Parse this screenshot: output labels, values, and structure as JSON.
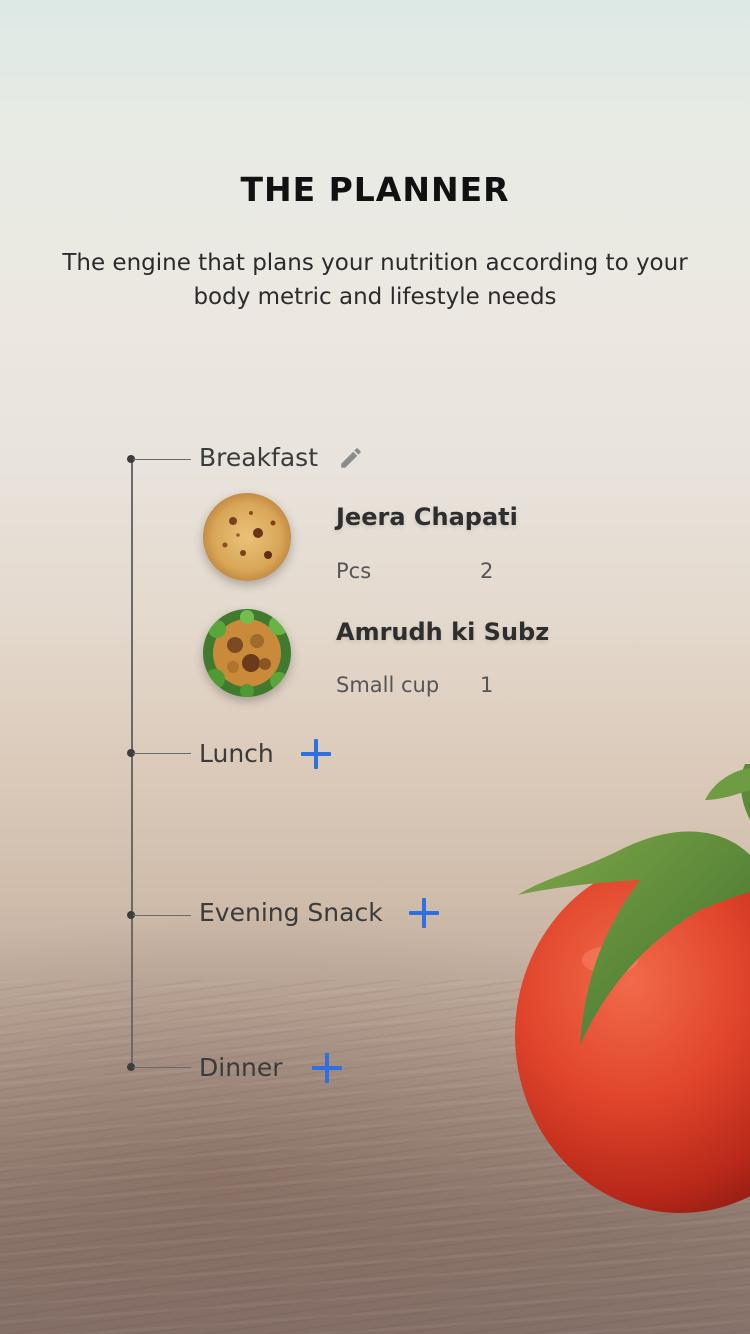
{
  "header": {
    "title": "THE PLANNER",
    "subtitle": "The engine that plans your nutrition according to your body metric and lifestyle needs"
  },
  "planner": {
    "meals": [
      {
        "label": "Breakfast",
        "action_icon": "pencil-icon",
        "items": [
          {
            "name": "Jeera Chapati",
            "unit": "Pcs",
            "qty": "2",
            "image_icon": "chapati-photo"
          },
          {
            "name": "Amrudh ki Subz",
            "unit": "Small cup",
            "qty": "1",
            "image_icon": "subz-photo"
          }
        ]
      },
      {
        "label": "Lunch",
        "action_icon": "plus-icon",
        "items": []
      },
      {
        "label": "Evening Snack",
        "action_icon": "plus-icon",
        "items": []
      },
      {
        "label": "Dinner",
        "action_icon": "plus-icon",
        "items": []
      }
    ]
  },
  "colors": {
    "accent": "#2f6fe0",
    "title": "#111111",
    "timeline": "#6a6a6a"
  }
}
